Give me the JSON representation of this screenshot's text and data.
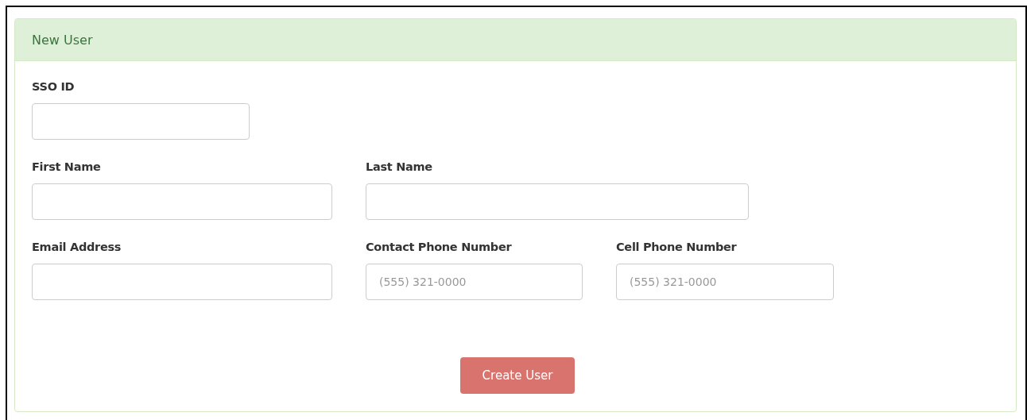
{
  "panel": {
    "title": "New User"
  },
  "form_rows": [
    [
      {
        "label": "SSO ID"
      }
    ],
    [
      {
        "label": "First Name"
      },
      {
        "label": "Last Name"
      }
    ],
    [
      {
        "label": "Email Address"
      },
      {
        "label": "Contact Phone Number",
        "placeholder": "(555) 321-0000"
      },
      {
        "label": "Cell Phone Number",
        "placeholder": "(555) 321-0000"
      }
    ]
  ],
  "submit_button": "Create User"
}
